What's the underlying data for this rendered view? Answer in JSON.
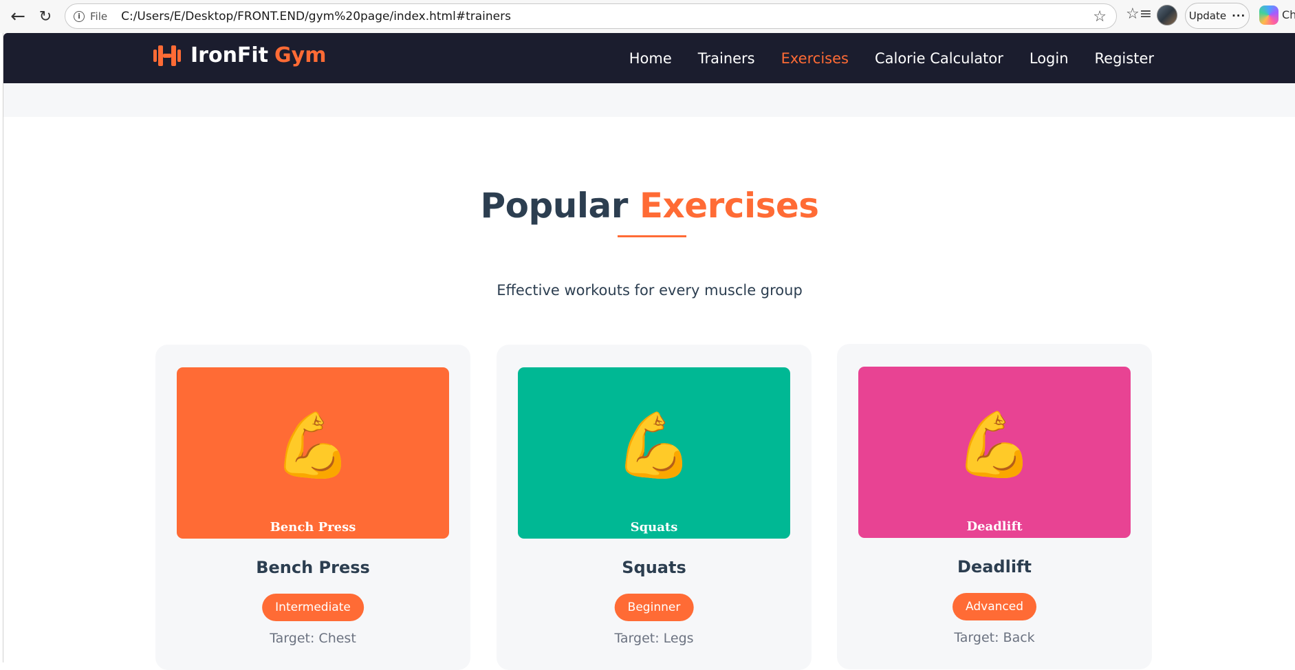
{
  "browser": {
    "file_label": "File",
    "url": "C:/Users/E/Desktop/FRONT.END/gym%20page/index.html#trainers",
    "update_label": "Update",
    "overflow_label": "···",
    "cut_text": "Ch"
  },
  "brand": {
    "name_part_1": "IronFit",
    "name_part_2": "Gym",
    "accent_color": "#ff6b35",
    "nav_bg": "#1b1d2e"
  },
  "nav": {
    "items": [
      {
        "label": "Home",
        "active": false
      },
      {
        "label": "Trainers",
        "active": false
      },
      {
        "label": "Exercises",
        "active": true
      },
      {
        "label": "Calorie Calculator",
        "active": false
      },
      {
        "label": "Login",
        "active": false
      },
      {
        "label": "Register",
        "active": false
      }
    ]
  },
  "section": {
    "title_part_1": "Popular",
    "title_part_2": "Exercises",
    "subtitle": "Effective workouts for every muscle group"
  },
  "exercises": [
    {
      "name": "Bench Press",
      "image_caption": "Bench Press",
      "image_icon": "flexed-biceps",
      "image_glyph": "💪",
      "image_color": "#ff6b35",
      "level": "Intermediate",
      "target": "Target: Chest"
    },
    {
      "name": "Squats",
      "image_caption": "Squats",
      "image_icon": "flexed-biceps",
      "image_glyph": "💪",
      "image_color": "#00b894",
      "level": "Beginner",
      "target": "Target: Legs"
    },
    {
      "name": "Deadlift",
      "image_caption": "Deadlift",
      "image_icon": "flexed-biceps",
      "image_glyph": "💪",
      "image_color": "#e84393",
      "level": "Advanced",
      "target": "Target: Back"
    }
  ]
}
